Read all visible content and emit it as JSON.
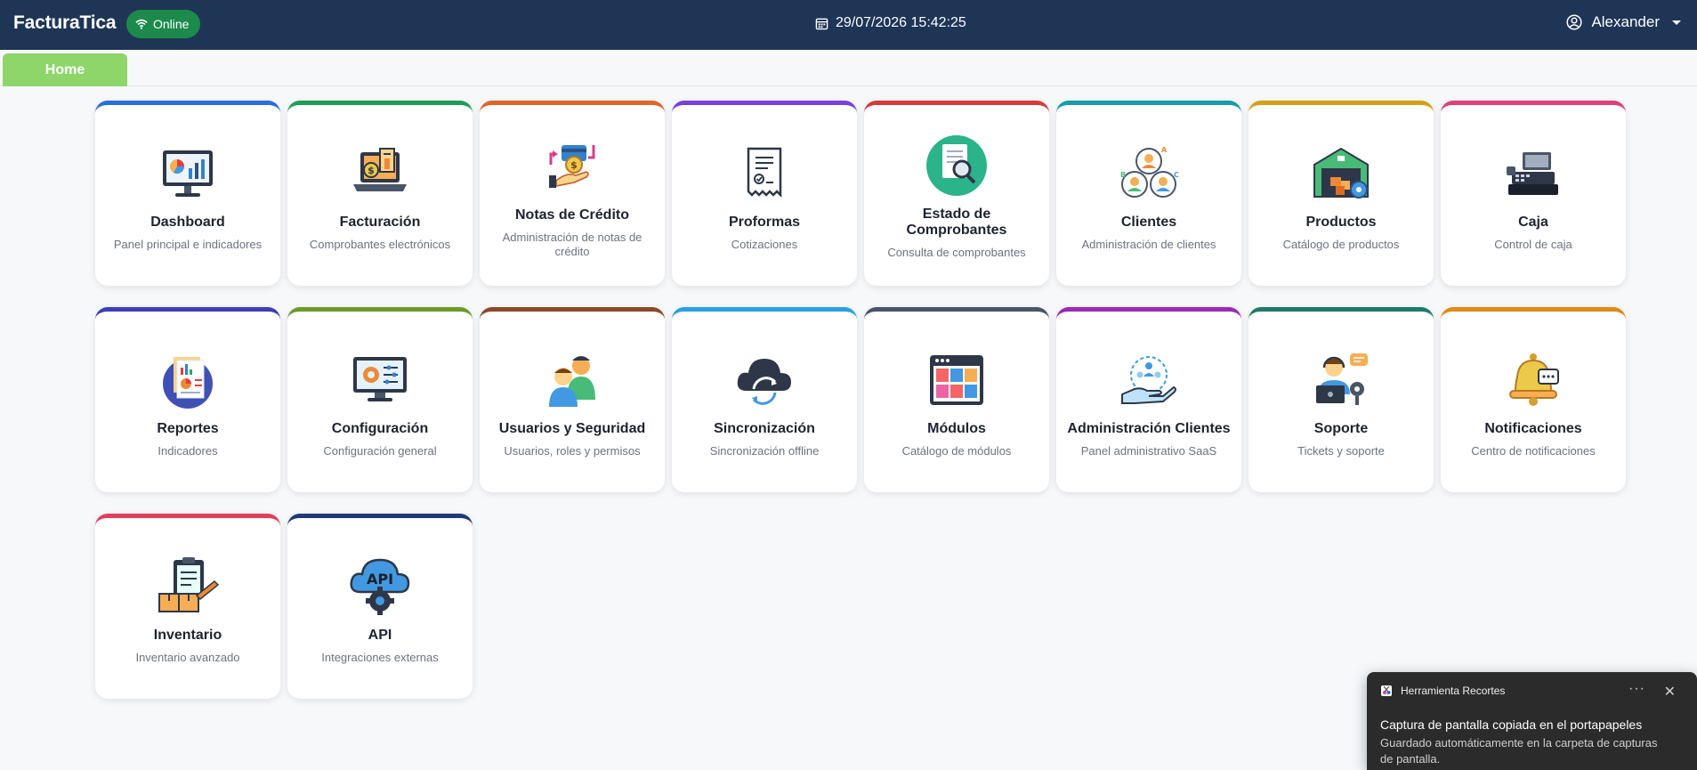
{
  "header": {
    "brand": "FacturaTica",
    "status": "Online",
    "datetime": "29/07/2026 15:42:25",
    "user": "Alexander"
  },
  "tabs": [
    {
      "label": "Home"
    }
  ],
  "modules": [
    {
      "title": "Dashboard",
      "subtitle": "Panel principal e indicadores",
      "color": "#2a6de0",
      "icon": "dashboard-icon"
    },
    {
      "title": "Facturación",
      "subtitle": "Comprobantes electrónicos",
      "color": "#1f9d55",
      "icon": "invoice-icon"
    },
    {
      "title": "Notas de Crédito",
      "subtitle": "Administración de notas de crédito",
      "color": "#e0642a",
      "icon": "credit-note-icon"
    },
    {
      "title": "Proformas",
      "subtitle": "Cotizaciones",
      "color": "#7b3fe0",
      "icon": "receipt-icon"
    },
    {
      "title": "Estado de Comprobantes",
      "subtitle": "Consulta de comprobantes",
      "color": "#d63a3a",
      "icon": "document-search-icon"
    },
    {
      "title": "Clientes",
      "subtitle": "Administración de clientes",
      "color": "#1a9bab",
      "icon": "clients-icon"
    },
    {
      "title": "Productos",
      "subtitle": "Catálogo de productos",
      "color": "#d4a017",
      "icon": "warehouse-icon"
    },
    {
      "title": "Caja",
      "subtitle": "Control de caja",
      "color": "#e0407a",
      "icon": "cash-register-icon"
    },
    {
      "title": "Reportes",
      "subtitle": "Indicadores",
      "color": "#3f3fb5",
      "icon": "reports-icon"
    },
    {
      "title": "Configuración",
      "subtitle": "Configuración general",
      "color": "#6b9a2a",
      "icon": "settings-monitor-icon"
    },
    {
      "title": "Usuarios y Seguridad",
      "subtitle": "Usuarios, roles y permisos",
      "color": "#8a4a2a",
      "icon": "users-icon"
    },
    {
      "title": "Sincronización",
      "subtitle": "Sincronización offline",
      "color": "#2aa0e0",
      "icon": "cloud-sync-icon"
    },
    {
      "title": "Módulos",
      "subtitle": "Catálogo de módulos",
      "color": "#4a5568",
      "icon": "modules-grid-icon"
    },
    {
      "title": "Administración Clientes",
      "subtitle": "Panel administrativo SaaS",
      "color": "#9b2ab5",
      "icon": "client-admin-icon"
    },
    {
      "title": "Soporte",
      "subtitle": "Tickets y soporte",
      "color": "#1f7a6a",
      "icon": "support-agent-icon"
    },
    {
      "title": "Notificaciones",
      "subtitle": "Centro de notificaciones",
      "color": "#e08a1a",
      "icon": "bell-icon"
    },
    {
      "title": "Inventario",
      "subtitle": "Inventario avanzado",
      "color": "#e0405a",
      "icon": "inventory-icon"
    },
    {
      "title": "API",
      "subtitle": "Integraciones externas",
      "color": "#1e3a7a",
      "icon": "api-cloud-icon"
    }
  ],
  "toast": {
    "app": "Herramienta Recortes",
    "more": "···",
    "close": "✕",
    "title": "Captura de pantalla copiada en el portapapeles",
    "body": "Guardado automáticamente en la carpeta de capturas de pantalla."
  }
}
